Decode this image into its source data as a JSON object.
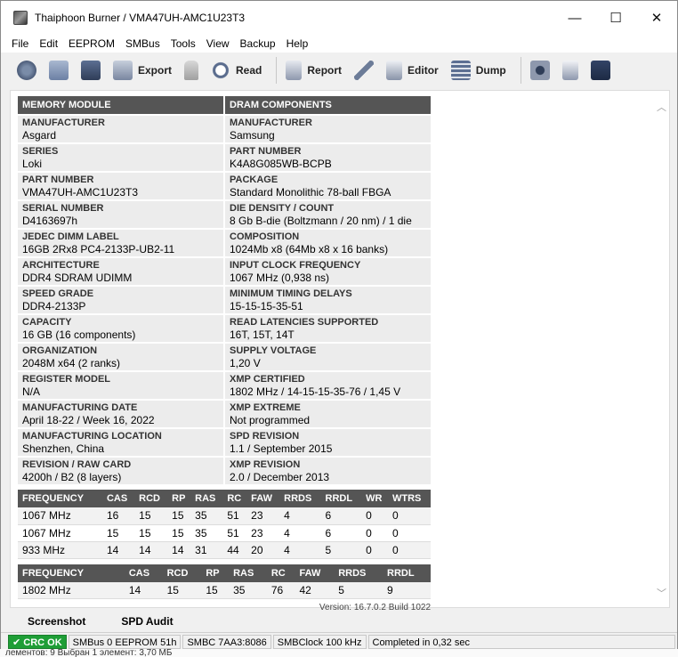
{
  "window": {
    "title": "Thaiphoon Burner / VMA47UH-AMC1U23T3",
    "minimize": "—",
    "maximize": "☐",
    "close": "✕"
  },
  "menu": [
    "File",
    "Edit",
    "EEPROM",
    "SMBus",
    "Tools",
    "View",
    "Backup",
    "Help"
  ],
  "toolbar": {
    "export_label": "Export",
    "read_label": "Read",
    "report_label": "Report",
    "editor_label": "Editor",
    "dump_label": "Dump"
  },
  "memory_module": {
    "header": "MEMORY MODULE",
    "rows": [
      {
        "k": "MANUFACTURER",
        "v": "Asgard"
      },
      {
        "k": "SERIES",
        "v": "Loki"
      },
      {
        "k": "PART NUMBER",
        "v": "VMA47UH-AMC1U23T3"
      },
      {
        "k": "SERIAL NUMBER",
        "v": "D4163697h"
      },
      {
        "k": "JEDEC DIMM LABEL",
        "v": "16GB 2Rx8 PC4-2133P-UB2-11"
      },
      {
        "k": "ARCHITECTURE",
        "v": "DDR4 SDRAM UDIMM"
      },
      {
        "k": "SPEED GRADE",
        "v": "DDR4-2133P"
      },
      {
        "k": "CAPACITY",
        "v": "16 GB (16 components)"
      },
      {
        "k": "ORGANIZATION",
        "v": "2048M x64 (2 ranks)"
      },
      {
        "k": "REGISTER MODEL",
        "v": "N/A"
      },
      {
        "k": "MANUFACTURING DATE",
        "v": "April 18-22 / Week 16, 2022"
      },
      {
        "k": "MANUFACTURING LOCATION",
        "v": "Shenzhen, China"
      },
      {
        "k": "REVISION / RAW CARD",
        "v": "4200h / B2 (8 layers)"
      }
    ]
  },
  "dram_components": {
    "header": "DRAM COMPONENTS",
    "rows": [
      {
        "k": "MANUFACTURER",
        "v": "Samsung"
      },
      {
        "k": "PART NUMBER",
        "v": "K4A8G085WB-BCPB"
      },
      {
        "k": "PACKAGE",
        "v": "Standard Monolithic 78-ball FBGA"
      },
      {
        "k": "DIE DENSITY / COUNT",
        "v": "8 Gb B-die (Boltzmann / 20 nm) / 1 die"
      },
      {
        "k": "COMPOSITION",
        "v": "1024Mb x8 (64Mb x8 x 16 banks)"
      },
      {
        "k": "INPUT CLOCK FREQUENCY",
        "v": "1067 MHz (0,938 ns)"
      },
      {
        "k": "MINIMUM TIMING DELAYS",
        "v": "15-15-15-35-51"
      },
      {
        "k": "READ LATENCIES SUPPORTED",
        "v": "16T, 15T, 14T"
      },
      {
        "k": "SUPPLY VOLTAGE",
        "v": "1,20 V"
      },
      {
        "k": "XMP CERTIFIED",
        "v": "1802 MHz / 14-15-15-35-76 / 1,45 V"
      },
      {
        "k": "XMP EXTREME",
        "v": "Not programmed"
      },
      {
        "k": "SPD REVISION",
        "v": "1.1 / September 2015"
      },
      {
        "k": "XMP REVISION",
        "v": "2.0 / December 2013"
      }
    ]
  },
  "jedec_timings": {
    "headers": [
      "FREQUENCY",
      "CAS",
      "RCD",
      "RP",
      "RAS",
      "RC",
      "FAW",
      "RRDS",
      "RRDL",
      "WR",
      "WTRS"
    ],
    "rows": [
      [
        "1067 MHz",
        "16",
        "15",
        "15",
        "35",
        "51",
        "23",
        "4",
        "6",
        "0",
        "0"
      ],
      [
        "1067 MHz",
        "15",
        "15",
        "15",
        "35",
        "51",
        "23",
        "4",
        "6",
        "0",
        "0"
      ],
      [
        "933 MHz",
        "14",
        "14",
        "14",
        "31",
        "44",
        "20",
        "4",
        "5",
        "0",
        "0"
      ]
    ]
  },
  "xmp_timings": {
    "headers": [
      "FREQUENCY",
      "",
      "CAS",
      "RCD",
      "RP",
      "RAS",
      "RC",
      "FAW",
      "RRDS",
      "RRDL"
    ],
    "rows": [
      [
        "1802 MHz",
        "",
        "14",
        "15",
        "15",
        "35",
        "76",
        "42",
        "5",
        "9"
      ]
    ]
  },
  "version_text": "Version: 16.7.0.2 Build 1022",
  "tabs": [
    "Screenshot",
    "SPD Audit"
  ],
  "status": {
    "crc": "✔ CRC OK",
    "smbus": "SMBus 0 EEPROM 51h",
    "smbc": "SMBC 7AA3:8086",
    "clock": "SMBClock 100 kHz",
    "completed": "Completed in 0,32 sec"
  },
  "behind_window_text": "лементов: 9     Выбран 1 элемент: 3,70 МБ",
  "colors": {
    "header_bg": "#555555",
    "cell_bg": "#ececec",
    "crc_ok": "#1e9e36"
  }
}
